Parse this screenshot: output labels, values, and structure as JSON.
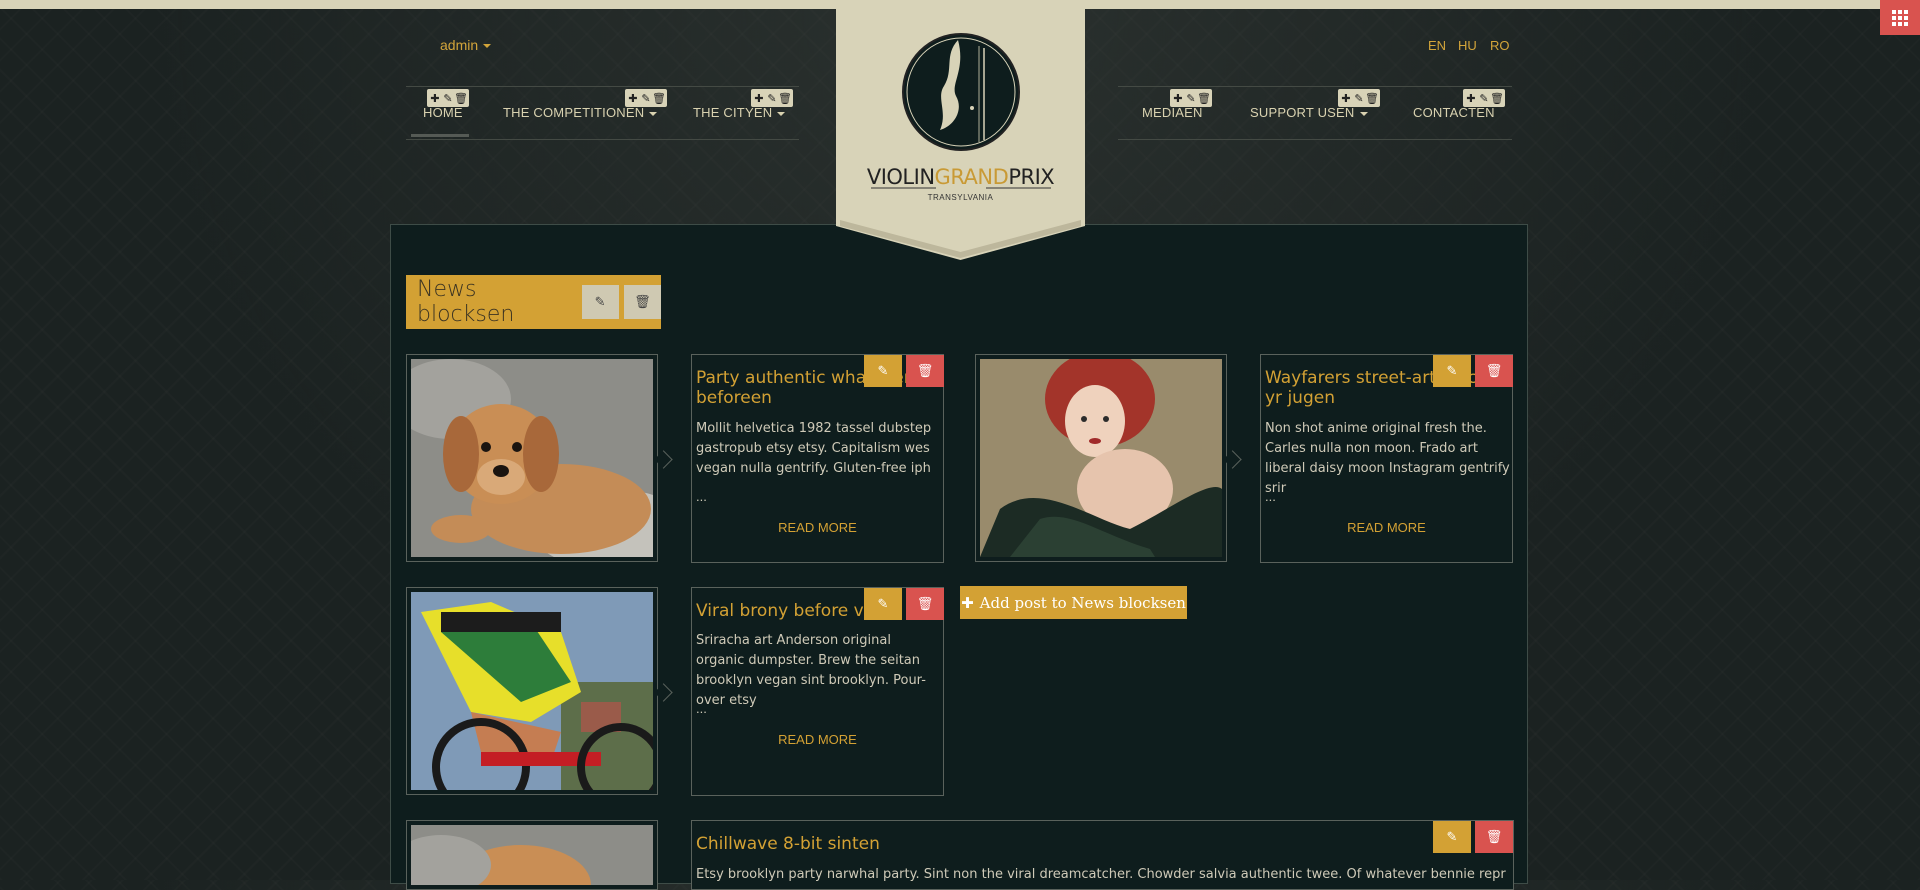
{
  "user_menu": {
    "label": "admin"
  },
  "languages": [
    "EN",
    "HU",
    "RO"
  ],
  "nav_left": [
    {
      "label": "HOME",
      "has_caret": false
    },
    {
      "label": "THE COMPETITIONEN",
      "has_caret": true
    },
    {
      "label": "THE CITYEN",
      "has_caret": true
    }
  ],
  "nav_right": [
    {
      "label": "MEDIAEN",
      "has_caret": false
    },
    {
      "label": "SUPPORT USEN",
      "has_caret": true
    },
    {
      "label": "CONTACTEN",
      "has_caret": false
    }
  ],
  "logo": {
    "part1": "VIOLIN",
    "part2": "GRAND",
    "part3": "PRIX",
    "subtitle": "TRANSYLVANIA"
  },
  "section": {
    "title": "News blocksen"
  },
  "posts": [
    {
      "title": "Party authentic whatever beforeen",
      "excerpt": "Mollit helvetica 1982 tassel dubstep gastropub etsy etsy. Capitalism wes vegan nulla gentrify. Gluten-free iph",
      "ellipsis": "...",
      "read_more": "READ MORE",
      "image": "puppy-photo"
    },
    {
      "title": "Wayfarers street-art dulce yr jugen",
      "excerpt": "Non shot anime original fresh the. Carles nulla non moon. Frado art liberal daisy moon Instagram gentrify srir",
      "ellipsis": "...",
      "read_more": "READ MORE",
      "image": "woman-portrait-photo"
    },
    {
      "title": "Viral brony before vinyl",
      "excerpt": "Sriracha art Anderson original organic dumpster. Brew the seitan brooklyn vegan sint brooklyn. Pour-over etsy",
      "ellipsis": "...",
      "read_more": "READ MORE",
      "image": "cyclist-photo"
    },
    {
      "title": "Chillwave 8-bit sinten",
      "excerpt": "Etsy brooklyn party narwhal party. Sint non the viral dreamcatcher. Chowder salvia authentic twee. Of whatever bennie reprehenderit",
      "image": "puppy-photo"
    }
  ],
  "add_post": {
    "label": "Add post to News blocksen"
  },
  "icons": {
    "add": "plus-icon",
    "edit": "edit-icon",
    "delete": "trash-icon",
    "apps": "grid-icon"
  },
  "colors": {
    "accent": "#d3a134",
    "danger": "#d9534f",
    "panel": "#0e1d1d",
    "cream": "#d8d3b8"
  }
}
